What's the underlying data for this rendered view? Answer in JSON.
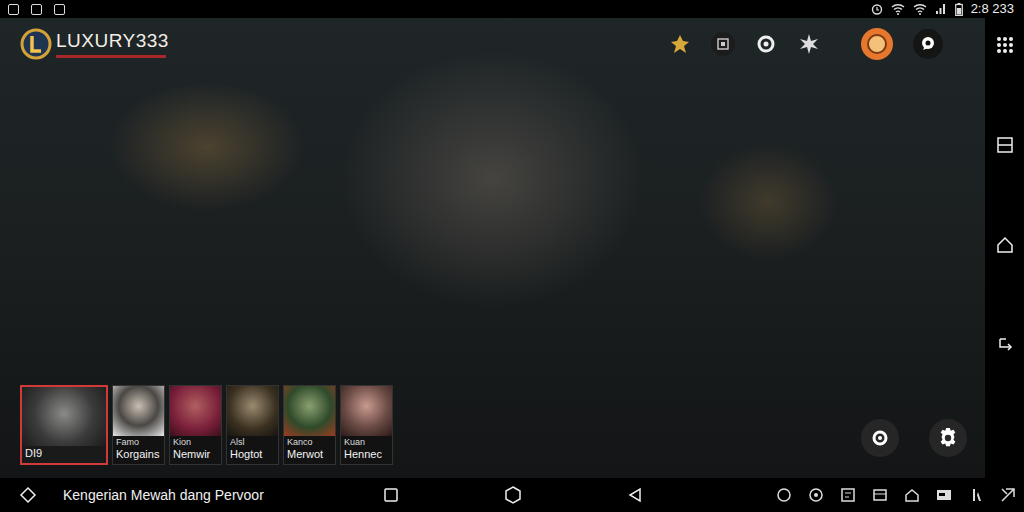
{
  "status_bar": {
    "time": "2:8 233"
  },
  "logo": {
    "text": "LUXURY333"
  },
  "characters": [
    {
      "lines": [
        "DI9"
      ],
      "selected": true
    },
    {
      "lines": [
        "Famo",
        "Korgains"
      ],
      "selected": false
    },
    {
      "lines": [
        "Kion",
        "Nemwir"
      ],
      "selected": false
    },
    {
      "lines": [
        "Alsl",
        "Hogtot"
      ],
      "selected": false
    },
    {
      "lines": [
        "Kanco",
        "Merwot"
      ],
      "selected": false
    },
    {
      "lines": [
        "Kuan",
        "Hennec"
      ],
      "selected": false
    }
  ],
  "nav_bar": {
    "title": "Kengerian Mewah dang Pervoor"
  }
}
